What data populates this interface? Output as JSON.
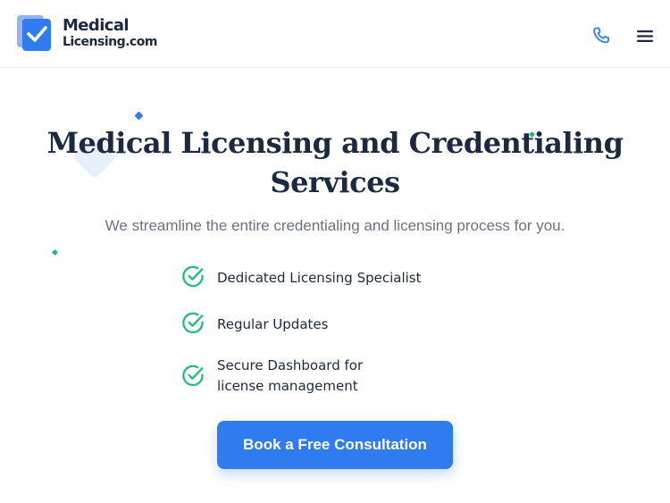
{
  "header": {
    "logo_line1": "Medical",
    "logo_line2": "Licensing.com",
    "phone_icon": "phone-icon",
    "menu_icon": "hamburger-menu-icon"
  },
  "hero": {
    "title_line1": "Medical Licensing and Credentialing",
    "title_line2": "Services",
    "subtitle": "We streamline the entire credentialing and licensing process for you.",
    "features": [
      {
        "label": "Dedicated Licensing Specialist",
        "icon": "check-circle-icon"
      },
      {
        "label": "Regular Updates",
        "icon": "check-circle-icon"
      },
      {
        "label": "Secure Dashboard for license management",
        "icon": "check-circle-icon"
      }
    ],
    "cta_label": "Book a Free Consultation"
  },
  "colors": {
    "primary": "#2f7bf0",
    "text_dark": "#1b2a41",
    "text_muted": "#6b7280",
    "check_green": "#1fbf75",
    "deco_light_blue": "#e8f0fe"
  }
}
